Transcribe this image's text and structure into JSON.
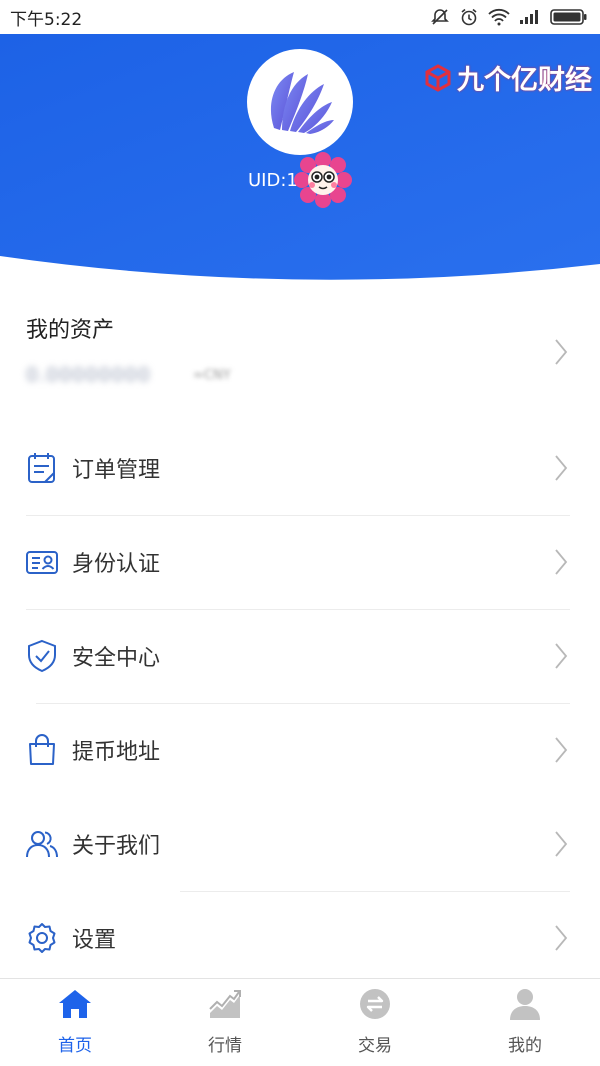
{
  "status_bar": {
    "time": "下午5:22"
  },
  "header": {
    "watermark": "九个亿财经",
    "uid_label": "UID:1"
  },
  "assets": {
    "title": "我的资产",
    "amount": "0.00000000",
    "unit": "≈CNY"
  },
  "menu": [
    {
      "label": "订单管理",
      "icon": "order-list-icon"
    },
    {
      "label": "身份认证",
      "icon": "id-card-icon"
    },
    {
      "label": "安全中心",
      "icon": "shield-check-icon"
    },
    {
      "label": "提币地址",
      "icon": "shopping-bag-icon"
    },
    {
      "label": "关于我们",
      "icon": "users-icon"
    },
    {
      "label": "设置",
      "icon": "gear-icon"
    }
  ],
  "tab_bar": {
    "active": "首页",
    "tabs": [
      {
        "label": "首页",
        "icon": "home-icon"
      },
      {
        "label": "行情",
        "icon": "market-chart-icon"
      },
      {
        "label": "交易",
        "icon": "exchange-icon"
      },
      {
        "label": "我的",
        "icon": "profile-icon"
      }
    ]
  },
  "colors": {
    "brand_blue": "#1f66e8",
    "tab_active": "#1e63ea",
    "tab_inactive": "#b5b5b5",
    "menu_icon": "#2b62c8"
  }
}
